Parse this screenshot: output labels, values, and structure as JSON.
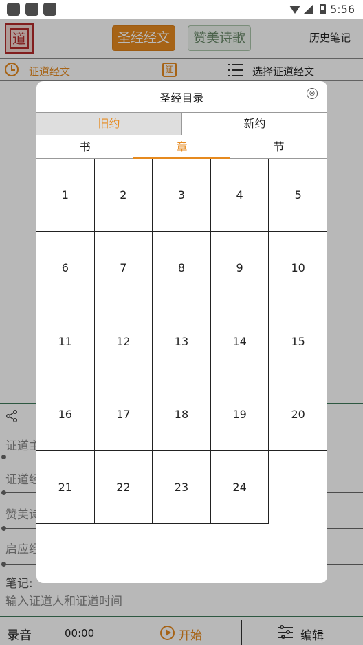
{
  "status_bar": {
    "time": "5:56"
  },
  "header": {
    "logo_char": "道",
    "tab_scripture": "圣经经文",
    "tab_hymns": "赞美诗歌",
    "history": "历史笔记"
  },
  "sub_header": {
    "left_label": "证道经文",
    "verse_icon_char": "证",
    "right_label": "选择证道经文"
  },
  "form": {
    "row1": "证道主",
    "row2": "证道经",
    "row3": "赞美诗",
    "row4": "启应经",
    "notes_label": "笔记:",
    "notes_placeholder": "输入证道人和证道时间"
  },
  "bottom_bar": {
    "record_label": "录音",
    "record_time": "00:00",
    "start_label": "开始",
    "edit_label": "编辑"
  },
  "dialog": {
    "title": "圣经目录",
    "close_glyph": "⊗",
    "testaments": [
      "旧约",
      "新约"
    ],
    "selected_testament": "旧约",
    "levels": [
      "书",
      "章",
      "节"
    ],
    "selected_level": "章",
    "chapters": [
      "1",
      "2",
      "3",
      "4",
      "5",
      "6",
      "7",
      "8",
      "9",
      "10",
      "11",
      "12",
      "13",
      "14",
      "15",
      "16",
      "17",
      "18",
      "19",
      "20",
      "21",
      "22",
      "23",
      "24"
    ]
  },
  "colors": {
    "accent": "#e68a1f",
    "green": "#3f7a5a"
  }
}
